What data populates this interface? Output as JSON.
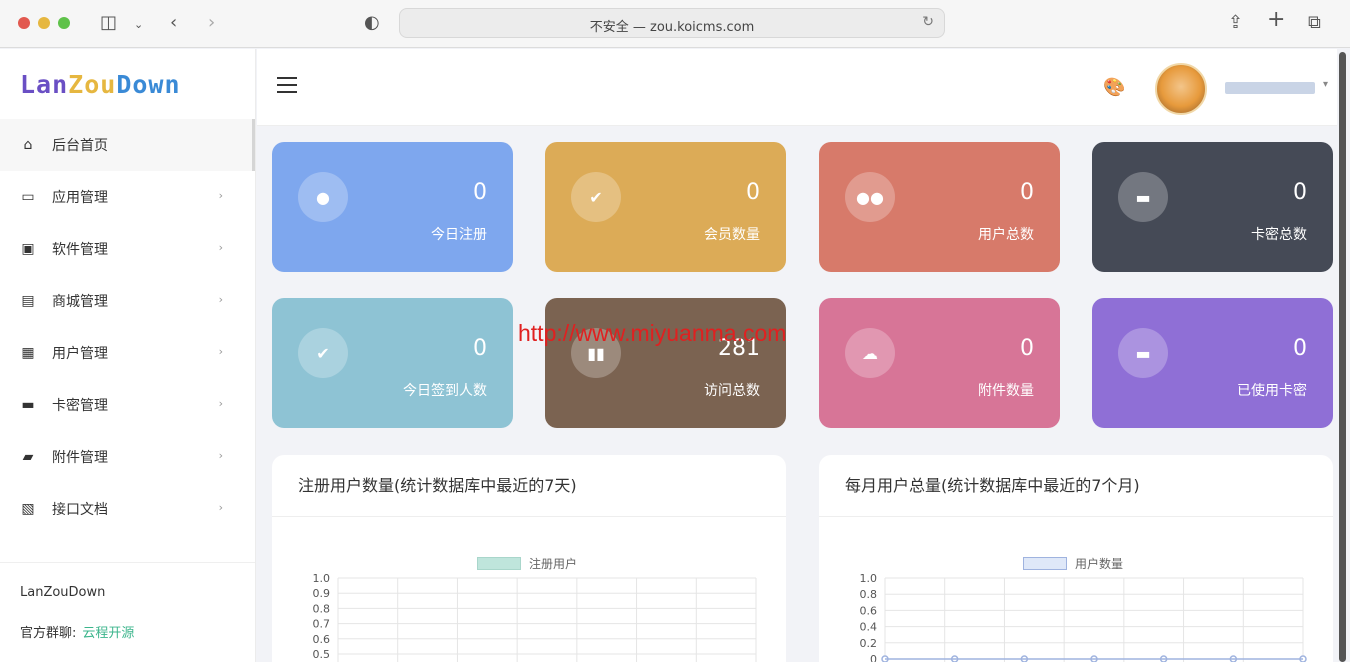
{
  "browser": {
    "url_text": "不安全 — zou.koicms.com"
  },
  "logo": {
    "part1": "Lan",
    "part2": "Zou",
    "part3": "Down"
  },
  "sidebar": {
    "items": [
      {
        "label": "后台首页",
        "icon": "home-icon",
        "glyph": "⌂"
      },
      {
        "label": "应用管理",
        "icon": "desktop-icon",
        "glyph": "▭"
      },
      {
        "label": "软件管理",
        "icon": "software-icon",
        "glyph": "▣"
      },
      {
        "label": "商城管理",
        "icon": "store-icon",
        "glyph": "▤"
      },
      {
        "label": "用户管理",
        "icon": "user-card-icon",
        "glyph": "▦"
      },
      {
        "label": "卡密管理",
        "icon": "card-icon",
        "glyph": "▬"
      },
      {
        "label": "附件管理",
        "icon": "folder-icon",
        "glyph": "▰"
      },
      {
        "label": "接口文档",
        "icon": "api-doc-icon",
        "glyph": "▧"
      }
    ],
    "footer_brand": "LanZouDown",
    "group_label": "官方群聊:",
    "group_link": "云程开源"
  },
  "stats": [
    {
      "value": "0",
      "label": "今日注册",
      "color": "#7ea7ee",
      "icon": "user-icon",
      "glyph": "●"
    },
    {
      "value": "0",
      "label": "会员数量",
      "color": "#dcab57",
      "icon": "member-icon",
      "glyph": "✔"
    },
    {
      "value": "0",
      "label": "用户总数",
      "color": "#d77a6a",
      "icon": "users-icon",
      "glyph": "●●"
    },
    {
      "value": "0",
      "label": "卡密总数",
      "color": "#454a56",
      "icon": "card-icon",
      "glyph": "▬"
    },
    {
      "value": "0",
      "label": "今日签到人数",
      "color": "#8ec3d4",
      "icon": "signin-icon",
      "glyph": "✔"
    },
    {
      "value": "281",
      "label": "访问总数",
      "color": "#7b6351",
      "icon": "bar-chart-icon",
      "glyph": "▮▮"
    },
    {
      "value": "0",
      "label": "附件数量",
      "color": "#d77597",
      "icon": "cloud-upload-icon",
      "glyph": "☁"
    },
    {
      "value": "0",
      "label": "已使用卡密",
      "color": "#8f6fd6",
      "icon": "card-used-icon",
      "glyph": "▬"
    }
  ],
  "watermark": "http://www.miyuanma.com",
  "panels": {
    "left_title": "注册用户数量(统计数据库中最近的7天)",
    "right_title": "每月用户总量(统计数据库中最近的7个月)"
  },
  "chart_data": [
    {
      "type": "bar",
      "title": "注册用户数量(统计数据库中最近的7天)",
      "series": [
        {
          "name": "注册用户",
          "values": [
            0,
            0,
            0,
            0,
            0,
            0,
            0
          ],
          "color": "#bfe5dc"
        }
      ],
      "yticks": [
        "1.0",
        "0.9",
        "0.8",
        "0.7",
        "0.6",
        "0.5"
      ],
      "ylim": [
        0,
        1
      ],
      "grid": true,
      "legend": "top"
    },
    {
      "type": "line",
      "title": "每月用户总量(统计数据库中最近的7个月)",
      "series": [
        {
          "name": "用户数量",
          "values": [
            0,
            0,
            0,
            0,
            0,
            0,
            0
          ],
          "color": "#dfe8f8"
        }
      ],
      "yticks": [
        "1.0",
        "0.8",
        "0.6",
        "0.4",
        "0.2",
        "0"
      ],
      "ylim": [
        0,
        1
      ],
      "grid": true,
      "legend": "top"
    }
  ]
}
